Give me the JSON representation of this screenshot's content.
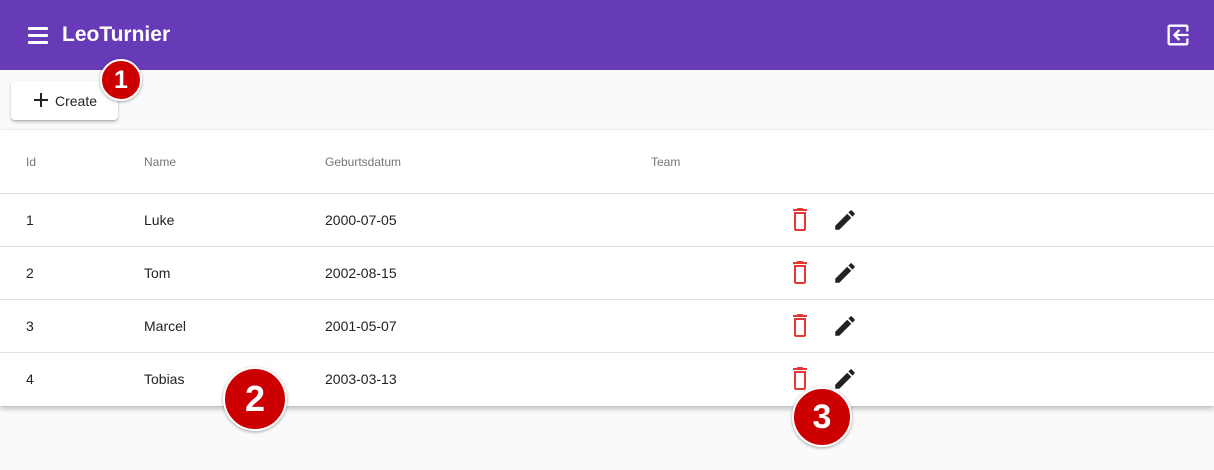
{
  "app": {
    "title": "LeoTurnier"
  },
  "toolbar": {
    "menu_icon": "menu-icon",
    "login_icon": "login-icon"
  },
  "actions": {
    "create_label": "Create"
  },
  "table": {
    "headers": [
      "Id",
      "Name",
      "Geburtsdatum",
      "Team"
    ],
    "rows": [
      {
        "id": "1",
        "name": "Luke",
        "birthdate": "2000-07-05",
        "team": ""
      },
      {
        "id": "2",
        "name": "Tom",
        "birthdate": "2002-08-15",
        "team": ""
      },
      {
        "id": "3",
        "name": "Marcel",
        "birthdate": "2001-05-07",
        "team": ""
      },
      {
        "id": "4",
        "name": "Tobias",
        "birthdate": "2003-03-13",
        "team": ""
      }
    ]
  },
  "annotations": [
    "1",
    "2",
    "3"
  ],
  "colors": {
    "primary": "#673ab7",
    "delete": "#e53935",
    "marker": "#cc0000"
  }
}
